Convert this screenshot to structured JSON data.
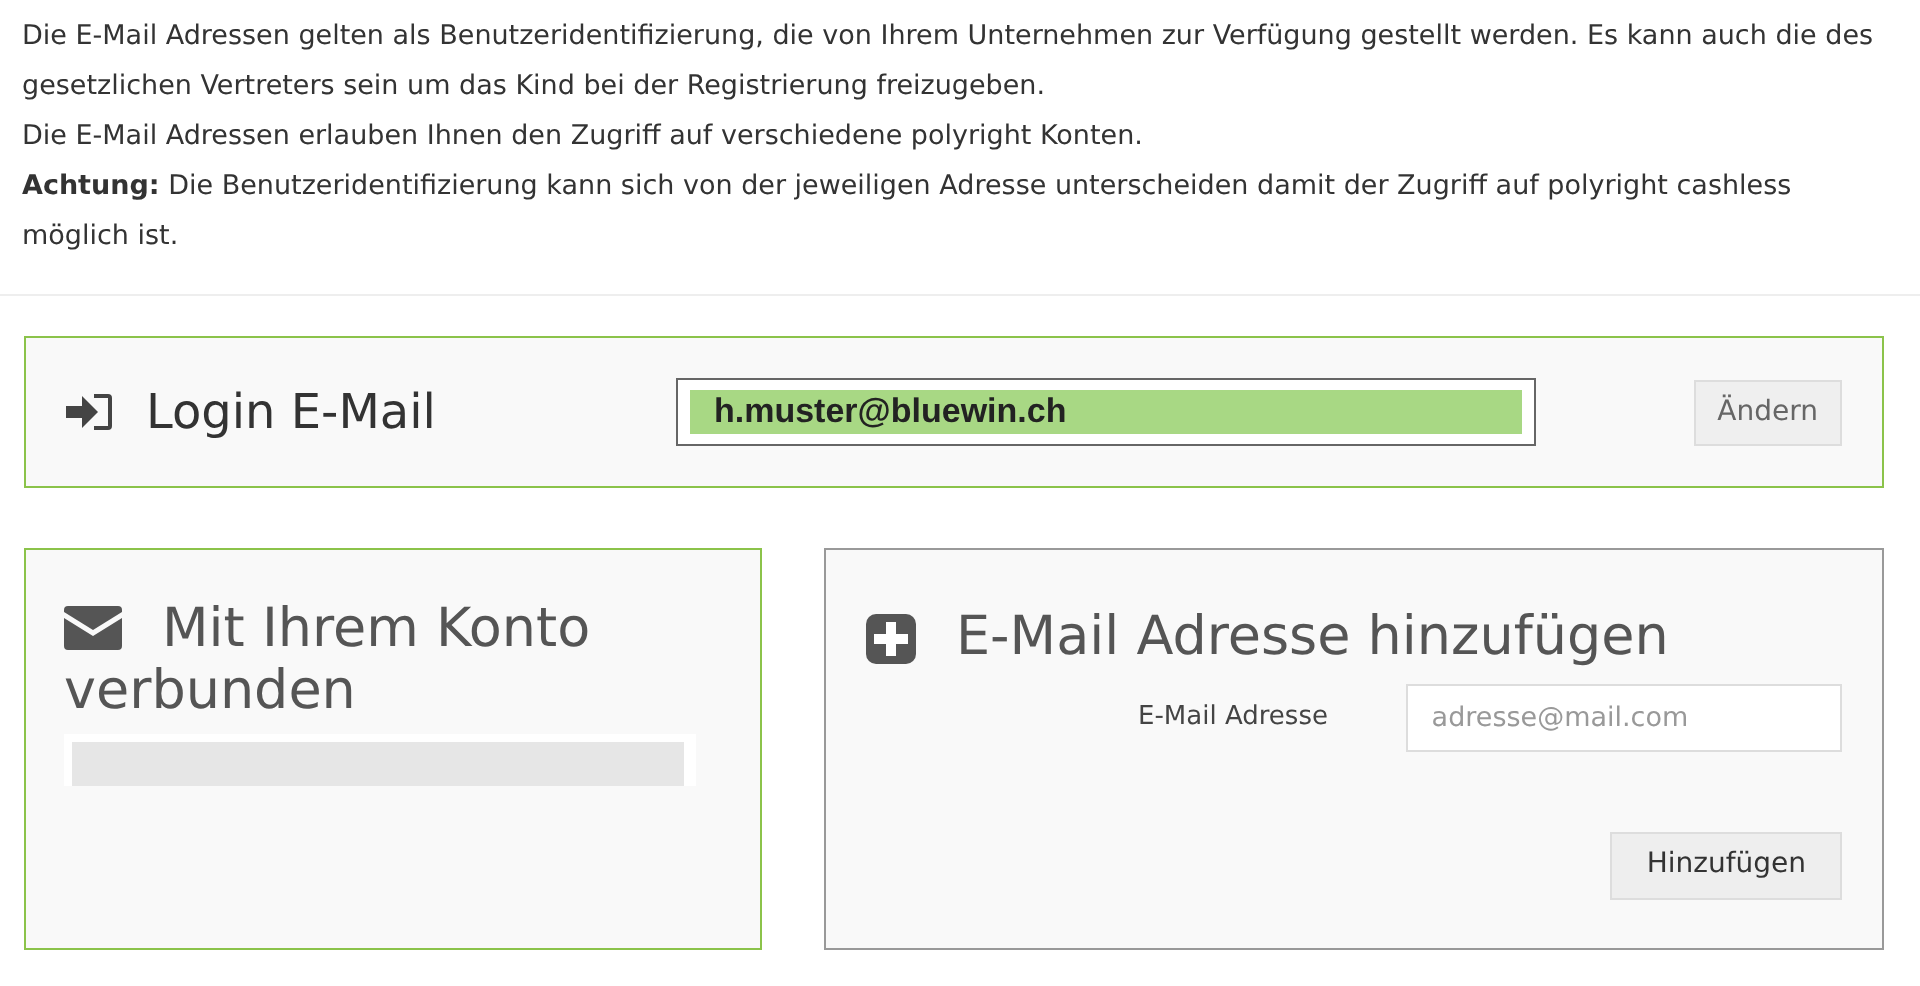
{
  "intro": {
    "paragraphs": [
      {
        "text": "Die E-Mail Adressen gelten als Benutzeridentifizierung, die von Ihrem Unternehmen zur Verfügung gestellt werden. Es kann auch die des gesetzlichen Vertreters sein um das Kind bei der Registrierung freizugeben."
      },
      {
        "text": "Die E-Mail Adressen erlauben Ihnen den Zugriff auf verschiedene polyright Konten."
      },
      {
        "text": "**Achtung:** Die Benutzeridentifizierung kann sich von der jeweiligen Adresse unterscheiden damit der Zugriff auf polyright cashless möglich ist."
      }
    ]
  },
  "login_panel": {
    "title": "Login E-Mail",
    "value": "h.muster@bluewin.ch",
    "button": "Ändern"
  },
  "linked_panel": {
    "title": "Mit Ihrem Konto verbunden"
  },
  "add_panel": {
    "title": "E-Mail Adresse hinzufügen",
    "field_label": "E-Mail Adresse",
    "placeholder": "adresse@mail.com",
    "button": "Hinzufügen"
  }
}
